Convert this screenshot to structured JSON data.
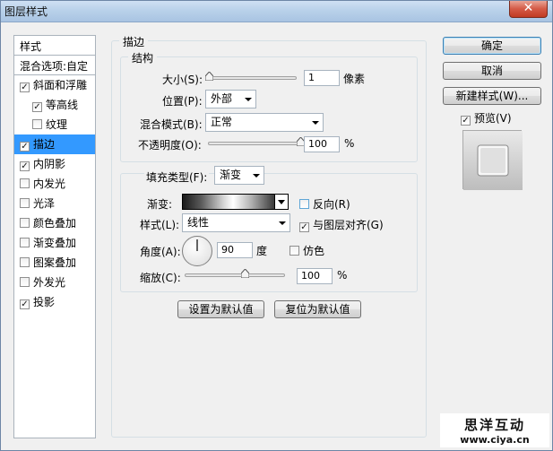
{
  "window": {
    "title": "图层样式",
    "close": "✕"
  },
  "stylelist": {
    "header": "样式",
    "blend": "混合选项:自定",
    "items": [
      {
        "label": "斜面和浮雕",
        "checked": true
      },
      {
        "label": "等高线",
        "checked": true
      },
      {
        "label": "纹理",
        "checked": false
      },
      {
        "label": "描边",
        "checked": true
      },
      {
        "label": "内阴影",
        "checked": true
      },
      {
        "label": "内发光",
        "checked": false
      },
      {
        "label": "光泽",
        "checked": false
      },
      {
        "label": "颜色叠加",
        "checked": false
      },
      {
        "label": "渐变叠加",
        "checked": false
      },
      {
        "label": "图案叠加",
        "checked": false
      },
      {
        "label": "外发光",
        "checked": false
      },
      {
        "label": "投影",
        "checked": true
      }
    ]
  },
  "stroke": {
    "title": "描边",
    "structure": {
      "title": "结构",
      "size_label": "大小(S):",
      "size_value": "1",
      "size_unit": "像素",
      "size_slider": 0.0,
      "position_label": "位置(P):",
      "position_value": "外部",
      "blend_label": "混合模式(B):",
      "blend_value": "正常",
      "opacity_label": "不透明度(O):",
      "opacity_value": "100",
      "opacity_unit": "%",
      "opacity_slider": 1.0
    },
    "fill": {
      "type_label": "填充类型(F):",
      "type_value": "渐变",
      "gradient_label": "渐变:",
      "reverse_label": "反向(R)",
      "reverse_checked": false,
      "style_label": "样式(L):",
      "style_value": "线性",
      "align_label": "与图层对齐(G)",
      "align_checked": true,
      "angle_label": "角度(A):",
      "angle_value": "90",
      "angle_unit": "度",
      "dither_label": "仿色",
      "dither_checked": false,
      "scale_label": "缩放(C):",
      "scale_value": "100",
      "scale_unit": "%",
      "scale_slider": 0.6
    },
    "make_default": "设置为默认值",
    "reset_default": "复位为默认值"
  },
  "buttons": {
    "ok": "确定",
    "cancel": "取消",
    "new_style": "新建样式(W)...",
    "preview_label": "预览(V)",
    "preview_checked": true
  },
  "watermark": {
    "line1": "思洋互动",
    "line2": "www.ciya.cn"
  }
}
